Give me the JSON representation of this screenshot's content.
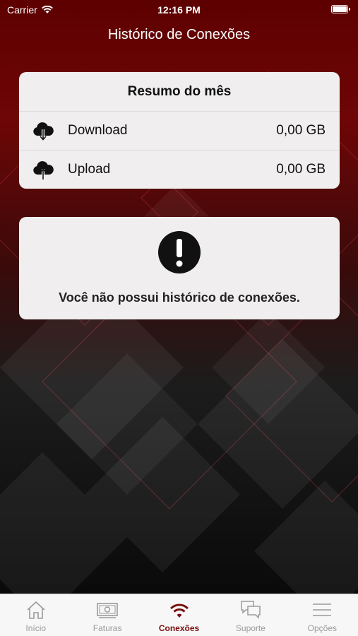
{
  "status_bar": {
    "carrier": "Carrier",
    "time": "12:16 PM"
  },
  "header": {
    "title": "Histórico de Conexões"
  },
  "summary": {
    "title": "Resumo do mês",
    "rows": [
      {
        "icon": "cloud-download-icon",
        "label": "Download",
        "value": "0,00 GB"
      },
      {
        "icon": "cloud-upload-icon",
        "label": "Upload",
        "value": "0,00 GB"
      }
    ]
  },
  "empty_state": {
    "icon": "exclamation-icon",
    "message": "Você não possui histórico de conexões."
  },
  "tabbar": {
    "active_color": "#7a0d0d",
    "inactive_color": "#9a9a9a",
    "tabs": [
      {
        "label": "Início",
        "icon": "home-icon",
        "active": false
      },
      {
        "label": "Faturas",
        "icon": "bill-icon",
        "active": false
      },
      {
        "label": "Conexões",
        "icon": "wifi-icon",
        "active": true
      },
      {
        "label": "Suporte",
        "icon": "chat-icon",
        "active": false
      },
      {
        "label": "Opções",
        "icon": "menu-icon",
        "active": false
      }
    ]
  }
}
